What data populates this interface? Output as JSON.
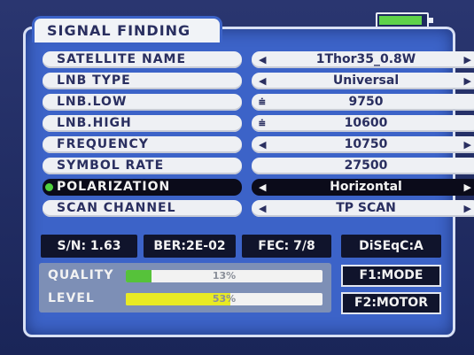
{
  "title": "SIGNAL FINDING",
  "battery_level": 0.8,
  "rows": [
    {
      "label": "SATELLITE NAME",
      "value": "1Thor35_0.8W",
      "arrows": true
    },
    {
      "label": "LNB TYPE",
      "value": "Universal",
      "arrows": true
    },
    {
      "label": "LNB.LOW",
      "value": "9750",
      "arrows": false,
      "numeric": true
    },
    {
      "label": "LNB.HIGH",
      "value": "10600",
      "arrows": false,
      "numeric": true
    },
    {
      "label": "FREQUENCY",
      "value": "10750",
      "arrows": true
    },
    {
      "label": "SYMBOL RATE",
      "value": "27500",
      "arrows": false
    },
    {
      "label": "POLARIZATION",
      "value": "Horizontal",
      "arrows": true,
      "active": true
    },
    {
      "label": "SCAN CHANNEL",
      "value": "TP SCAN",
      "arrows": true
    }
  ],
  "status": {
    "sn": "S/N:  1.63",
    "ber": "BER:2E-02",
    "fec": "FEC:  7/8",
    "diseqc": "DiSEqC:A"
  },
  "meters": {
    "quality": {
      "label": "QUALITY",
      "percent": 13,
      "text": "13%",
      "color": "#56c23a"
    },
    "level": {
      "label": "LEVEL",
      "percent": 53,
      "text": "53%",
      "color": "#e8ea24"
    }
  },
  "function_keys": {
    "f1": "F1:MODE",
    "f2": "F2:MOTOR"
  },
  "glyphs": {
    "left": "◀",
    "right": "▶",
    "numeric": "⩧"
  }
}
